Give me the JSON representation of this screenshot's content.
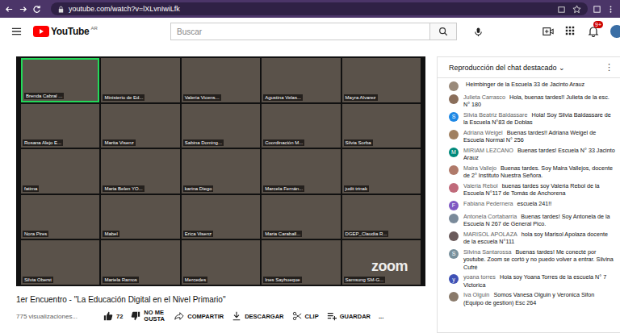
{
  "browser": {
    "url": "youtube.com/watch?v=lXLvnIwiLfk"
  },
  "header": {
    "logo": "YouTube",
    "region": "AR",
    "search_placeholder": "Buscar",
    "notifications": "9+"
  },
  "video": {
    "watermark": "zoom",
    "participants": [
      {
        "name": "Brenda Cabral ...",
        "speaking": true
      },
      {
        "name": "Ministerio de Ed...",
        "speaking": false
      },
      {
        "name": "Valeria Vicens...",
        "speaking": false
      },
      {
        "name": "Agustina Velas...",
        "speaking": false
      },
      {
        "name": "Mayra Alvarez",
        "speaking": false
      },
      {
        "name": "Rosana Alejo E...",
        "speaking": false
      },
      {
        "name": "Marita Visenz",
        "speaking": false
      },
      {
        "name": "Sabina Doming...",
        "speaking": false
      },
      {
        "name": "Coordinación M...",
        "speaking": false
      },
      {
        "name": "Silvia Sorba",
        "speaking": false
      },
      {
        "name": "fatima",
        "speaking": false
      },
      {
        "name": "Maria Belen YO...",
        "speaking": false
      },
      {
        "name": "karina Diego",
        "speaking": false
      },
      {
        "name": "Marcela Fernán...",
        "speaking": false
      },
      {
        "name": "judit trinak",
        "speaking": false
      },
      {
        "name": "Nora Pires",
        "speaking": false
      },
      {
        "name": "Mabel",
        "speaking": false
      },
      {
        "name": "Erica Visenz",
        "speaking": false
      },
      {
        "name": "Maria Caraball...",
        "speaking": false
      },
      {
        "name": "DGEP_Claudia R...",
        "speaking": false
      },
      {
        "name": "Silvia Oberst",
        "speaking": false
      },
      {
        "name": "Mariela Ramos",
        "speaking": false
      },
      {
        "name": "Mercedes",
        "speaking": false
      },
      {
        "name": "Ines Sayhueque",
        "speaking": false
      },
      {
        "name": "Samsung SM-G...",
        "speaking": false
      }
    ]
  },
  "title": "1er Encuentro - \"La Educación Digital en el Nivel Primario\"",
  "views": "775 visualizaciones...",
  "actions": [
    {
      "kind": "like",
      "label": "72"
    },
    {
      "kind": "dislike",
      "label": "NO ME GUSTA"
    },
    {
      "kind": "share",
      "label": "COMPARTIR"
    },
    {
      "kind": "download",
      "label": "DESCARGAR"
    },
    {
      "kind": "clip",
      "label": "CLIP"
    },
    {
      "kind": "save",
      "label": "GUARDAR"
    },
    {
      "kind": "more",
      "label": "..."
    }
  ],
  "chat": {
    "title": "Reproducción del chat destacado",
    "chevron": "⌄",
    "menu": "⋮",
    "messages": [
      {
        "avatar": "",
        "color": "#9a8a7a",
        "name": "",
        "text": "Heimbinger de la Escuela 33 de Jacinto Arauz"
      },
      {
        "avatar": "",
        "color": "#8a6e5a",
        "name": "Julieta Carrasco",
        "text": "Hola, buenas tardes!! Julieta de la esc. N° 180"
      },
      {
        "avatar": "S",
        "color": "#1e88e5",
        "name": "Silvia Beatriz Baldassare",
        "text": "Hola! Soy Silvia Baldassare de la Escuela N°83 de Doblas"
      },
      {
        "avatar": "",
        "color": "#a08060",
        "name": "Adriana Weigel",
        "text": "Buenas tardes!! Adriana Weigel de Escuela Normal N° 256"
      },
      {
        "avatar": "M",
        "color": "#00897b",
        "name": "MIRIAM LEZCANO",
        "text": "Buenas tardes! Escuela N° 33 Jacinto Arauz"
      },
      {
        "avatar": "",
        "color": "#b07a6a",
        "name": "Maira Vallejo",
        "text": "Buenas tardes. Soy Maira Vallejos, docente de 2° Instituto Nuestra Señora."
      },
      {
        "avatar": "",
        "color": "#c06a7a",
        "name": "Valeria Rebol",
        "text": "buenas tardes soy Valeria Rebol de la Escuela N°117 de Tomás de Anchorena"
      },
      {
        "avatar": "F",
        "color": "#7e57c2",
        "name": "Fabiana Pedernera",
        "text": "escuela 241!!"
      },
      {
        "avatar": "",
        "color": "#7a8a9a",
        "name": "Antonela Cortabarria",
        "text": "Buenas tardes! Soy Antonela de la Escuela N 267 de General Pico."
      },
      {
        "avatar": "",
        "color": "#6a5a5a",
        "name": "MARISOL APOLAZA",
        "text": "hola soy Marisol Apolaza docente de la escuela N°111"
      },
      {
        "avatar": "S",
        "color": "#78909c",
        "name": "Silvina Santarossa",
        "text": "Buenas tardes! Me conecté por youtube. Zoom se cortó y no puedo volver a entrar. Silvina Cufré"
      },
      {
        "avatar": "y",
        "color": "#3f51b5",
        "name": "yoana torres",
        "text": "Hola soy Yoana Torres de la escuela N° 7 Victorica"
      },
      {
        "avatar": "",
        "color": "#8a7a6a",
        "name": "Iva Olguin",
        "text": "Somos Vanesa Olguin y Veronica Sifon (Equipo de gestion) Esc 264"
      }
    ]
  }
}
